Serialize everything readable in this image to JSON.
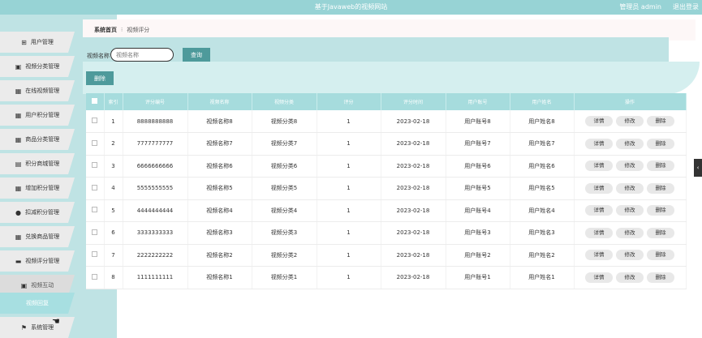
{
  "header": {
    "title": "基于Javaweb的视频网站",
    "user": "管理员 admin",
    "logout": "退出登录"
  },
  "sidebar": {
    "items": [
      {
        "label": "用户管理",
        "icon": "⊞"
      },
      {
        "label": "视频分类管理",
        "icon": "▣"
      },
      {
        "label": "在线视频管理",
        "icon": "▦"
      },
      {
        "label": "用户积分管理",
        "icon": "▦"
      },
      {
        "label": "商品分类管理",
        "icon": "▦"
      },
      {
        "label": "积分商城管理",
        "icon": "▤"
      },
      {
        "label": "增加积分管理",
        "icon": "▦"
      },
      {
        "label": "扣减积分管理",
        "icon": "●"
      },
      {
        "label": "兑换商品管理",
        "icon": "▦"
      },
      {
        "label": "视频评分管理",
        "icon": "▬"
      },
      {
        "label": "视频互动",
        "icon": "▣"
      },
      {
        "label": "视频回复",
        "icon": ""
      },
      {
        "label": "系统管理",
        "icon": "⚑"
      }
    ]
  },
  "breadcrumb": {
    "home": "系统首页",
    "sep": "⁝",
    "current": "视频评分"
  },
  "search": {
    "label": "视频名称",
    "placeholder": "视频名称",
    "button": "查询"
  },
  "toolbar": {
    "delete": "删除"
  },
  "table": {
    "headers": [
      "",
      "索引",
      "评分编号",
      "视频名称",
      "视频分类",
      "评分",
      "评分时间",
      "用户账号",
      "用户姓名",
      "操作"
    ],
    "actions": {
      "detail": "详情",
      "edit": "修改",
      "delete": "删除"
    },
    "rows": [
      [
        "1",
        "8888888888",
        "视频名称8",
        "视频分类8",
        "1",
        "2023-02-18",
        "用户账号8",
        "用户姓名8"
      ],
      [
        "2",
        "7777777777",
        "视频名称7",
        "视频分类7",
        "1",
        "2023-02-18",
        "用户账号7",
        "用户姓名7"
      ],
      [
        "3",
        "6666666666",
        "视频名称6",
        "视频分类6",
        "1",
        "2023-02-18",
        "用户账号6",
        "用户姓名6"
      ],
      [
        "4",
        "5555555555",
        "视频名称5",
        "视频分类5",
        "1",
        "2023-02-18",
        "用户账号5",
        "用户姓名5"
      ],
      [
        "5",
        "4444444444",
        "视频名称4",
        "视频分类4",
        "1",
        "2023-02-18",
        "用户账号4",
        "用户姓名4"
      ],
      [
        "6",
        "3333333333",
        "视频名称3",
        "视频分类3",
        "1",
        "2023-02-18",
        "用户账号3",
        "用户姓名3"
      ],
      [
        "7",
        "2222222222",
        "视频名称2",
        "视频分类2",
        "1",
        "2023-02-18",
        "用户账号2",
        "用户姓名2"
      ],
      [
        "8",
        "1111111111",
        "视频名称1",
        "视频分类1",
        "1",
        "2023-02-18",
        "用户账号1",
        "用户姓名1"
      ]
    ]
  },
  "side_tab": "‹",
  "colors": {
    "accent": "#97d3d5",
    "button": "#4e9a9b",
    "sidebar": "#bfe3e4"
  }
}
